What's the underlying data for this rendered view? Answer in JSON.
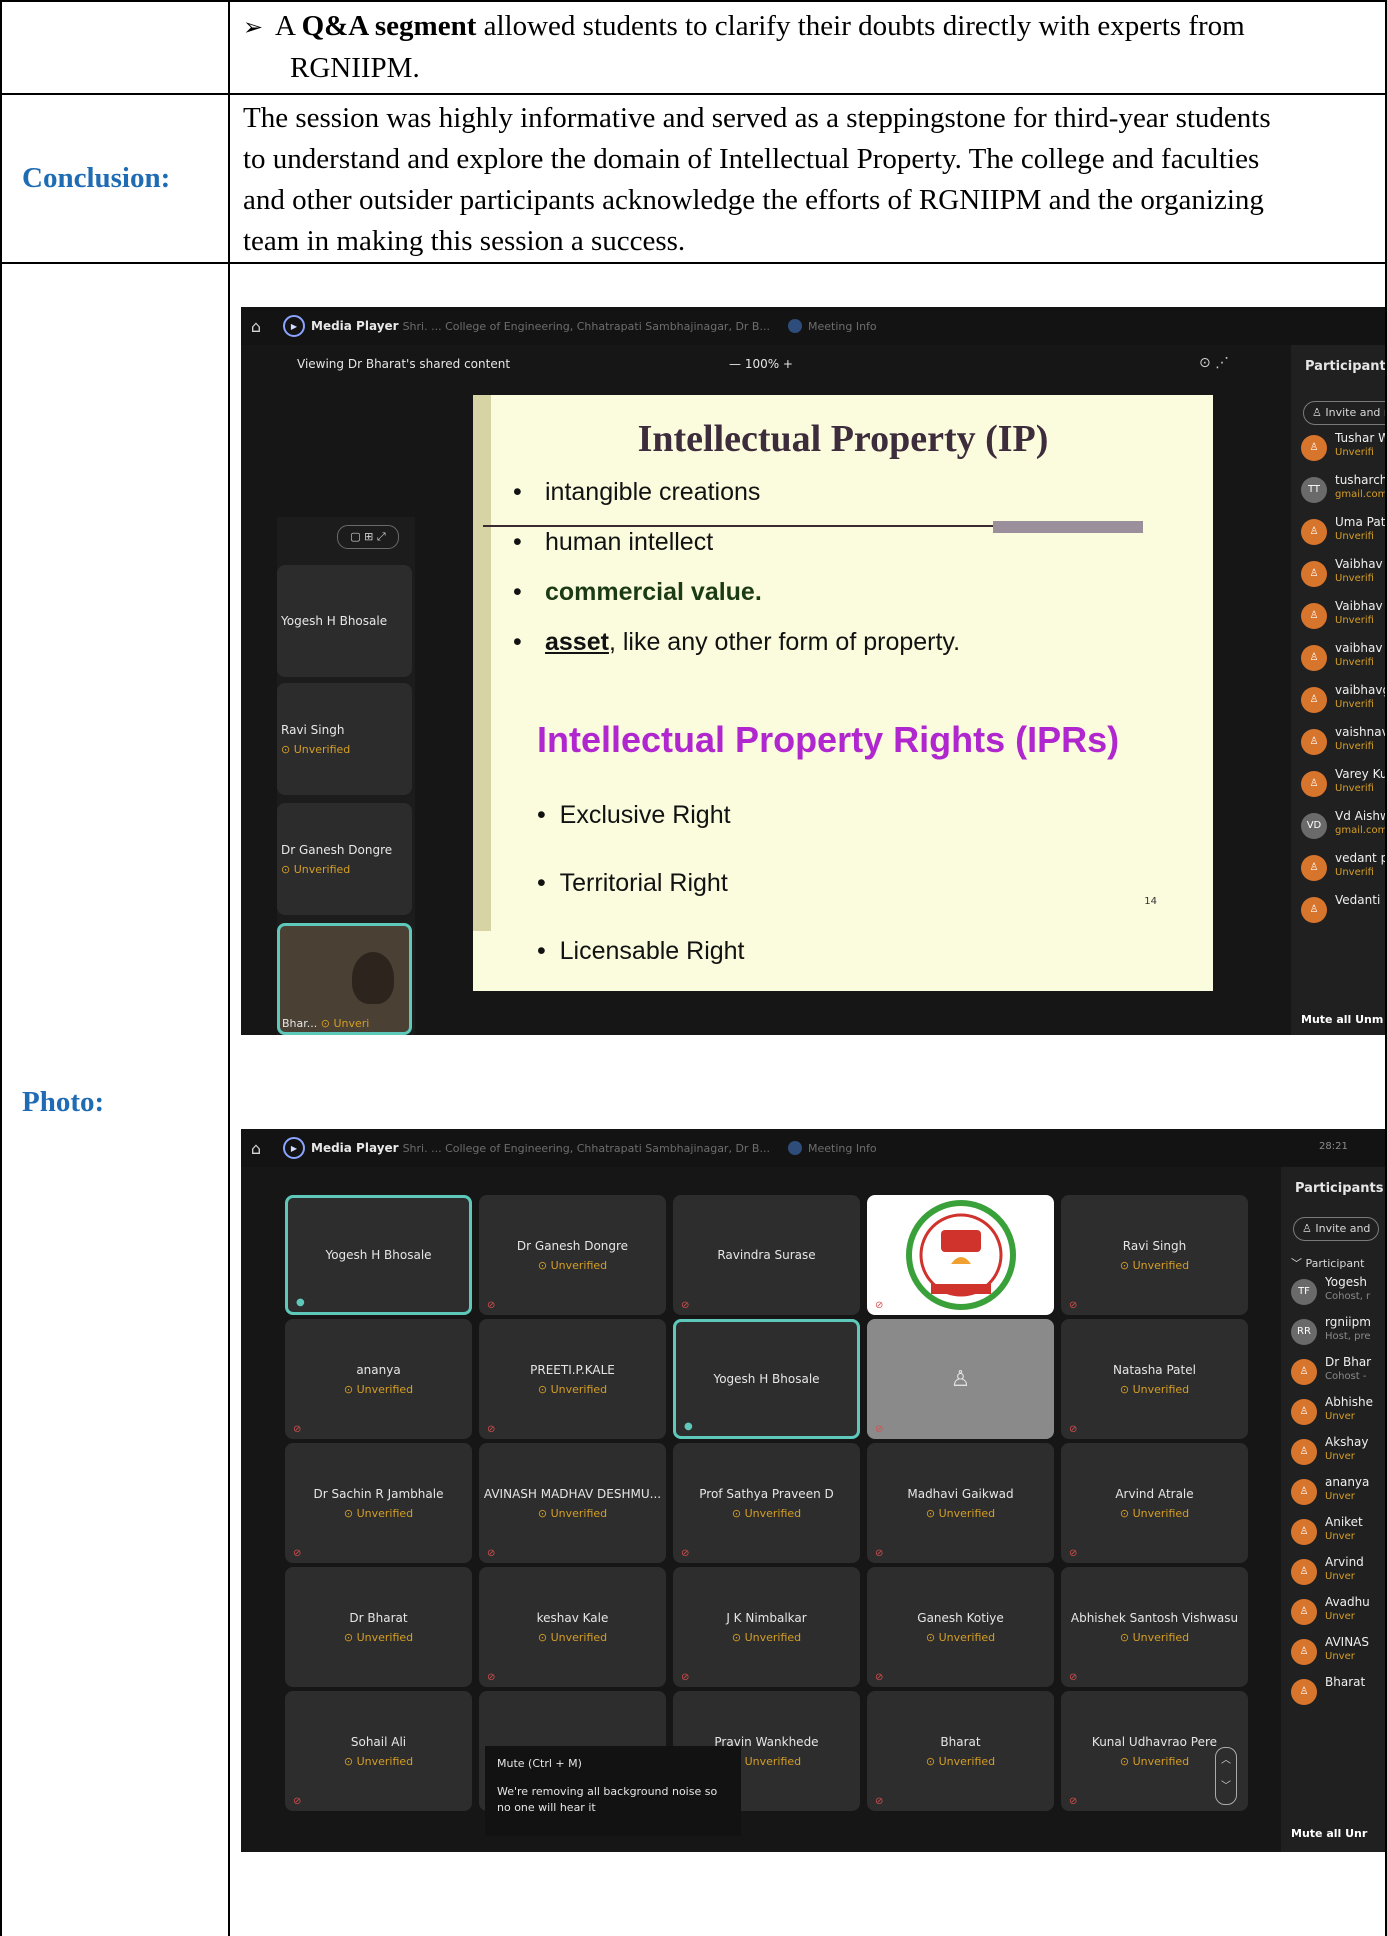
{
  "row1": {
    "bullet": "➢",
    "text_pre": "A ",
    "text_bold": "Q&A segment",
    "text_post": " allowed students to clarify their doubts directly with experts from",
    "text_line2": "RGNIIPM."
  },
  "row2": {
    "label": "Conclusion:",
    "lines": [
      "The session was highly informative and served as a steppingstone for third-year students",
      "to understand and explore the domain of Intellectual Property. The college and faculties",
      "and other outsider participants acknowledge the efforts of RGNIIPM and the organizing",
      "team in making this session a success."
    ]
  },
  "row3": {
    "label": "Photo:"
  },
  "shot1": {
    "app": "Media Player",
    "window_title": "Shri. ... College of Engineering, Chhatrapati Sambhajinagar, Dr B...",
    "meeting_info": "Meeting Info",
    "share_text": "Viewing Dr Bharat's shared content",
    "zoom": "—   100%   +",
    "slide": {
      "title": "Intellectual Property (IP)",
      "bullets": [
        "intangible creations",
        "human intellect",
        "commercial value.",
        "asset"
      ],
      "bullet4_rest": ", like any other form of property.",
      "subtitle": "Intellectual Property Rights (IPRs)",
      "rights": [
        "Exclusive Right",
        "Territorial Right",
        "Licensable Right"
      ],
      "page": "14"
    },
    "videos": [
      {
        "name": "Yogesh H Bhosale",
        "status": ""
      },
      {
        "name": "Ravi Singh",
        "status": "Unverified"
      },
      {
        "name": "Dr Ganesh Dongre",
        "status": "Unverified"
      },
      {
        "name": "Bhar...",
        "status": "Unveri"
      }
    ],
    "participants": {
      "title": "Participants",
      "invite": "Invite and r",
      "items": [
        {
          "initials": "",
          "name": "Tushar W",
          "sub": "Unverifi"
        },
        {
          "initials": "TT",
          "name": "tusharch",
          "sub": "gmail.com"
        },
        {
          "initials": "",
          "name": "Uma Pat",
          "sub": "Unverifi"
        },
        {
          "initials": "",
          "name": "Vaibhav",
          "sub": "Unverifi"
        },
        {
          "initials": "",
          "name": "Vaibhav",
          "sub": "Unverifi"
        },
        {
          "initials": "",
          "name": "vaibhav",
          "sub": "Unverifi"
        },
        {
          "initials": "",
          "name": "vaibhavg",
          "sub": "Unverifi"
        },
        {
          "initials": "",
          "name": "vaishnav",
          "sub": "Unverifi"
        },
        {
          "initials": "",
          "name": "Varey Ku",
          "sub": "Unverifi"
        },
        {
          "initials": "VD",
          "name": "Vd Aishw",
          "sub": "gmail.com"
        },
        {
          "initials": "",
          "name": "vedant p",
          "sub": "Unverifi"
        },
        {
          "initials": "",
          "name": "Vedanti",
          "sub": ""
        }
      ],
      "mute_all": "Mute all   Unm"
    }
  },
  "shot2": {
    "app": "Media Player",
    "window_title": "Shri. ... College of Engineering, Chhatrapati Sambhajinagar, Dr B...",
    "meeting_info": "Meeting Info",
    "time": "28:21",
    "tiles": [
      {
        "name": "Yogesh H Bhosale",
        "status": "",
        "style": "active",
        "icon": "mic"
      },
      {
        "name": "Dr Ganesh Dongre",
        "status": "Unverified",
        "style": "",
        "icon": "mute"
      },
      {
        "name": "Ravindra Surase",
        "status": "",
        "style": "",
        "icon": "mute"
      },
      {
        "name": "",
        "status": "",
        "style": "logo",
        "icon": "mute"
      },
      {
        "name": "Ravi Singh",
        "status": "Unverified",
        "style": "",
        "icon": "mute"
      },
      {
        "name": "ananya",
        "status": "Unverified",
        "style": "",
        "icon": "mute"
      },
      {
        "name": "PREETI.P.KALE",
        "status": "Unverified",
        "style": "",
        "icon": "mute"
      },
      {
        "name": "Yogesh H Bhosale",
        "status": "",
        "style": "active",
        "icon": "mic"
      },
      {
        "name": "",
        "status": "",
        "style": "gray",
        "icon": "mute"
      },
      {
        "name": "Natasha Patel",
        "status": "Unverified",
        "style": "",
        "icon": "mute"
      },
      {
        "name": "Dr Sachin R Jambhale",
        "status": "Unverified",
        "style": "",
        "icon": "mute"
      },
      {
        "name": "AVINASH MADHAV DESHMU...",
        "status": "Unverified",
        "style": "",
        "icon": "mute"
      },
      {
        "name": "Prof Sathya Praveen D",
        "status": "Unverified",
        "style": "",
        "icon": "mute"
      },
      {
        "name": "Madhavi Gaikwad",
        "status": "Unverified",
        "style": "",
        "icon": "mute"
      },
      {
        "name": "Arvind Atrale",
        "status": "Unverified",
        "style": "",
        "icon": "mute"
      },
      {
        "name": "Dr Bharat",
        "status": "Unverified",
        "style": "",
        "icon": ""
      },
      {
        "name": "keshav Kale",
        "status": "Unverified",
        "style": "",
        "icon": "mute"
      },
      {
        "name": "J K Nimbalkar",
        "status": "Unverified",
        "style": "",
        "icon": "mute"
      },
      {
        "name": "Ganesh Kotiye",
        "status": "Unverified",
        "style": "",
        "icon": "mute"
      },
      {
        "name": "Abhishek Santosh Vishwasu",
        "status": "Unverified",
        "style": "",
        "icon": "mute"
      },
      {
        "name": "Sohail Ali",
        "status": "Unverified",
        "style": "",
        "icon": "mute"
      },
      {
        "name": "",
        "status": "",
        "style": "",
        "icon": ""
      },
      {
        "name": "Pravin Wankhede",
        "status": "Unverified",
        "style": "",
        "icon": "mute"
      },
      {
        "name": "Bharat",
        "status": "Unverified",
        "style": "",
        "icon": "mute"
      },
      {
        "name": "Kunal Udhavrao Pere",
        "status": "Unverified",
        "style": "",
        "icon": "mute"
      }
    ],
    "tooltip": {
      "head": "Mute  (Ctrl + M)",
      "body": "We're removing all background noise so no one will hear it"
    },
    "participants": {
      "title": "Participants",
      "invite": "Invite and",
      "section": "Participant",
      "items": [
        {
          "initials": "TF",
          "name": "Yogesh",
          "sub": "Cohost, r"
        },
        {
          "initials": "RR",
          "name": "rgniipm",
          "sub": "Host, pre"
        },
        {
          "initials": "",
          "name": "Dr Bhar",
          "sub": "Cohost -"
        },
        {
          "initials": "",
          "name": "Abhishe",
          "sub": "Unver"
        },
        {
          "initials": "",
          "name": "Akshay",
          "sub": "Unver"
        },
        {
          "initials": "",
          "name": "ananya",
          "sub": "Unver"
        },
        {
          "initials": "",
          "name": "Aniket",
          "sub": "Unver"
        },
        {
          "initials": "",
          "name": "Arvind",
          "sub": "Unver"
        },
        {
          "initials": "",
          "name": "Avadhu",
          "sub": "Unver"
        },
        {
          "initials": "",
          "name": "AVINAS",
          "sub": "Unver"
        },
        {
          "initials": "",
          "name": "Bharat",
          "sub": ""
        }
      ],
      "mute_all": "Mute all   Unr"
    }
  }
}
